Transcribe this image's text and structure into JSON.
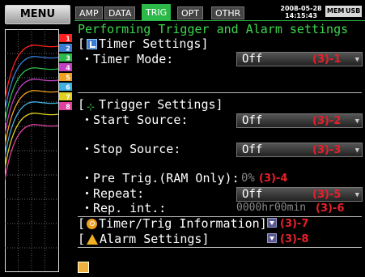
{
  "menu": {
    "label": "MENU"
  },
  "tabs": [
    {
      "label": "AMP",
      "active": false
    },
    {
      "label": "DATA",
      "active": false
    },
    {
      "label": "TRIG",
      "active": true
    },
    {
      "label": "OPT",
      "active": false
    },
    {
      "label": "OTHR",
      "active": false
    }
  ],
  "status": {
    "date": "2008-05-28",
    "time": "14:15:43",
    "mem_badge": "MEM",
    "usb_badge": "USB"
  },
  "page_title": "Performing Trigger and Alarm settings",
  "timer_settings": {
    "header": "Timer Settings]",
    "bracket": "[",
    "mode_label": "・Timer Mode:",
    "mode_value": "Off",
    "note": "(3)-1"
  },
  "trigger_settings": {
    "bracket": "[",
    "header": "Trigger Settings]",
    "start_label": "・Start Source:",
    "start_value": "Off",
    "start_note": "(3)-2",
    "stop_label": "・Stop Source:",
    "stop_value": "Off",
    "stop_note": "(3)-3",
    "pretrig_label": "・Pre Trig.(RAM Only):",
    "pretrig_value": "0%",
    "pretrig_note": "(3)-4",
    "repeat_label": "・Repeat:",
    "repeat_value": "Off",
    "repeat_note": "(3)-5",
    "repint_label": "・Rep. int.:",
    "repint_value": "0000hr00min",
    "repint_note": "(3)-6"
  },
  "info": {
    "bracket": "[",
    "header": "Timer/Trig Information]",
    "note": "(3)-7"
  },
  "alarm": {
    "bracket": "[",
    "header": "Alarm Settings]",
    "note": "(3)-8"
  },
  "channels": [
    "1",
    "2",
    "3",
    "4",
    "5",
    "6",
    "7",
    "8"
  ],
  "channel_colors": [
    "#ff2020",
    "#3a7bd5",
    "#2db84a",
    "#c040c0",
    "#f0a020",
    "#40b0e0",
    "#e0d020",
    "#e040a0"
  ],
  "icons": [
    "timer-icon",
    "trigger-icon",
    "info-icon",
    "alarm-icon",
    "help-icon",
    "expand-icon",
    "dropdown-icon"
  ]
}
